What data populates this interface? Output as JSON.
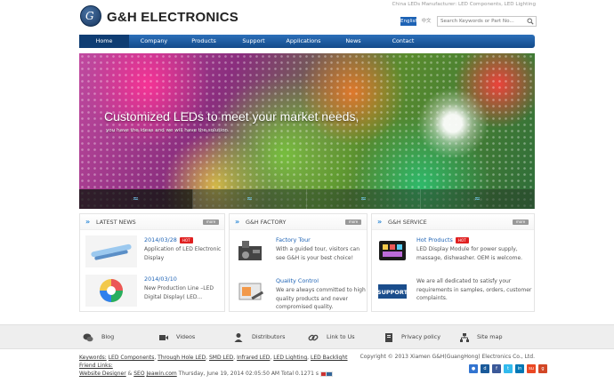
{
  "header": {
    "logo_glyph": "G",
    "brand": "G&H ELECTRONICS",
    "tagline": "China LEDs Manufacturer: LED Components, LED Lighting",
    "lang_en": "English",
    "lang_cn": "中文",
    "search_placeholder": "Search Keywords or Part No..."
  },
  "nav": {
    "items": [
      "Home",
      "Company",
      "Products",
      "Support",
      "Applications",
      "News",
      "Contact"
    ],
    "active": "Home"
  },
  "banner": {
    "title": "Customized LEDs to meet your market needs,",
    "subtitle": "you have the ideas and we will have the solution.",
    "slide_indicator": "≈"
  },
  "panels": {
    "news": {
      "title": "LATEST NEWS",
      "more": "more",
      "items": [
        {
          "title": "2014/03/28",
          "hot": "HOT",
          "text": "Application of LED Electronic Display"
        },
        {
          "title": "2014/03/10",
          "text": "New Production Line –LED Digital Display( LED..."
        }
      ]
    },
    "factory": {
      "title": "G&H FACTORY",
      "more": "more",
      "items": [
        {
          "title": "Factory Tour",
          "text": "With a guided tour, visitors can see G&H is your best choice!"
        },
        {
          "title": "Quality Control",
          "text": "We are always committed to high quality products and never compromised quality."
        }
      ]
    },
    "service": {
      "title": "G&H SERVICE",
      "more": "more",
      "items": [
        {
          "title": "Hot Products",
          "hot": "HOT",
          "text": "LED Display Module for power supply, massage, dishwasher. OEM is welcome."
        },
        {
          "title": "",
          "text": "We are all dedicated to satisfy your requirements in samples, orders, customer complaints.",
          "thumb_label": "SUPPORT"
        }
      ]
    }
  },
  "footer_links": [
    "Blog",
    "Videos",
    "Distributors",
    "Link to Us",
    "Privacy policy",
    "Site map"
  ],
  "bottom": {
    "keywords_label": "Keywords:",
    "keywords": [
      "LED Components",
      "Through Hole LED",
      "SMD LED",
      "Infrared LED",
      "LED Lighting",
      "LED Backlight"
    ],
    "friend_links": "Friend Links:",
    "designer": "Website Designer",
    "amp": "&",
    "seo": "SEO",
    "seo_site": "Jeawin.com",
    "timestamp": "Thursday, June 19, 2014 02:05:50 AM Total 0.1271 s",
    "copyright": "Copyright © 2013 Xiamen G&H(GuangHong) Electronics Co., Ltd."
  },
  "social": [
    {
      "name": "delicious",
      "color": "#3274d0"
    },
    {
      "name": "digg",
      "color": "#1a5a9a"
    },
    {
      "name": "facebook",
      "color": "#3b5998"
    },
    {
      "name": "twitter",
      "color": "#33bbee"
    },
    {
      "name": "linkedin",
      "color": "#0077b5"
    },
    {
      "name": "stumbleupon",
      "color": "#eb4823"
    },
    {
      "name": "google",
      "color": "#d24726"
    }
  ]
}
